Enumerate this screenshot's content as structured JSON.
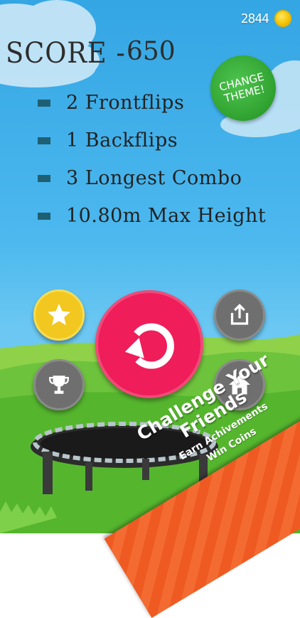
{
  "hud": {
    "coins": "2844",
    "coin_icon": "coin-icon"
  },
  "score": {
    "label": "SCORE -",
    "value": "650"
  },
  "theme_button": {
    "line1": "CHANGE",
    "line2": "THEME!"
  },
  "stats": [
    {
      "text": "2 Frontflips"
    },
    {
      "text": "1 Backflips"
    },
    {
      "text": "3 Longest Combo"
    },
    {
      "text": "10.80m Max Height"
    }
  ],
  "buttons": {
    "rate": {
      "icon": "star-icon"
    },
    "leaderboard": {
      "icon": "trophy-icon"
    },
    "replay": {
      "icon": "replay-icon"
    },
    "share": {
      "icon": "share-icon"
    },
    "home": {
      "icon": "home-icon"
    }
  },
  "promo": {
    "title_line1": "Challenge Your",
    "title_line2": "Friends",
    "sub_line1": "Earn Achivements",
    "sub_line2": "Win Coins"
  },
  "colors": {
    "sky": "#4cb8ee",
    "grass": "#62bd3c",
    "replay": "#ef1d5a",
    "star": "#f2c820",
    "theme": "#2fa12f",
    "banner": "#ee5a22"
  }
}
